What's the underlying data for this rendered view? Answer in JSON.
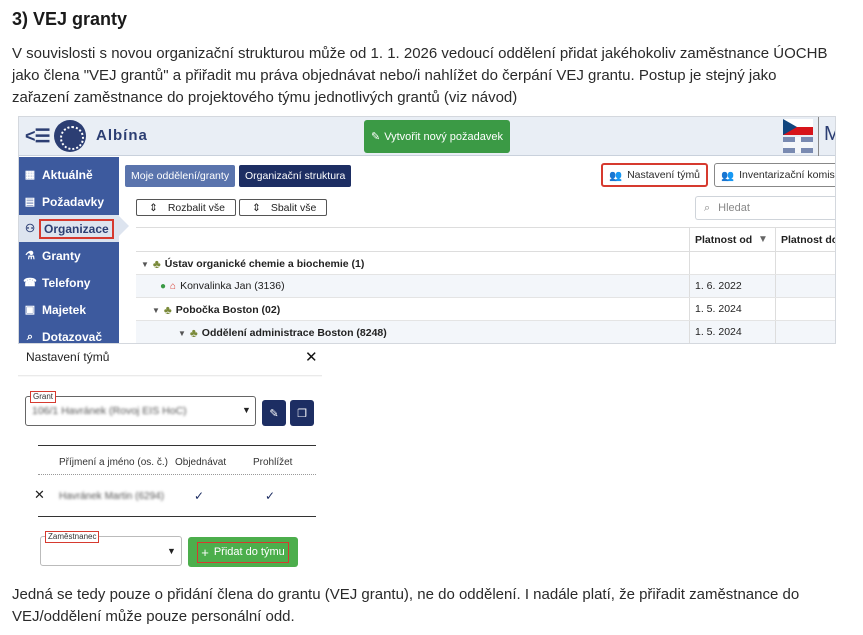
{
  "doc": {
    "heading": "3) VEJ granty",
    "intro_lines": [
      "V souvislosti s novou organizační strukturou může od 1. 1. 2026 vedoucí oddělení přidat jakéhokoliv zaměstnance ÚOCHB",
      "jako člena \"VEJ grantů\" a přiřadit mu práva objednávat nebo/i nahlížet do čerpání VEJ grantu. Postup je stejný jako",
      "zařazení zaměstnance do projektového týmu jednotlivých grantů (viz návod)"
    ],
    "outro_lines": [
      "Jedná se tedy pouze o přidání člena do grantu (VEJ grantu), ne do oddělení. I nadále platí, že přiřadit zaměstnance do",
      "VEJ/oddělení může pouze personální odd."
    ]
  },
  "app": {
    "name": "Albína",
    "create_request": "Vytvořit nový požadavek",
    "header_cut_text": "M",
    "sidebar": [
      {
        "label": "Aktuálně",
        "icon": "calendar-icon",
        "glyph": "▦"
      },
      {
        "label": "Požadavky",
        "icon": "document-icon",
        "glyph": "▤"
      },
      {
        "label": "Organizace",
        "icon": "org-chart-icon",
        "glyph": "⚇"
      },
      {
        "label": "Granty",
        "icon": "flask-icon",
        "glyph": "⚗"
      },
      {
        "label": "Telefony",
        "icon": "phone-icon",
        "glyph": "☎"
      },
      {
        "label": "Majetek",
        "icon": "briefcase-icon",
        "glyph": "▣"
      },
      {
        "label": "Dotazovač",
        "icon": "search-icon",
        "glyph": "⌕"
      }
    ],
    "active_sidebar": "Organizace",
    "tabs": [
      "Moje oddělení/granty",
      "Organizační struktura"
    ],
    "team_settings_btn": "Nastavení týmů",
    "inventory_btn": "Inventarizační komise",
    "expand_all": "Rozbalit vše",
    "collapse_all": "Sbalit vše",
    "search_placeholder": "Hledat",
    "columns": [
      "Platnost od",
      "Platnost do"
    ],
    "rows": [
      {
        "name": "Ústav organické chemie a biochemie (1)",
        "valid_from": "",
        "bold": true
      },
      {
        "name": "Konvalinka Jan (3136)",
        "valid_from": "1. 6. 2022",
        "bold": false
      },
      {
        "name": "Pobočka Boston (02)",
        "valid_from": "1. 5. 2024",
        "bold": true
      },
      {
        "name": "Oddělení administrace Boston (8248)",
        "valid_from": "1. 5. 2024",
        "bold": true
      }
    ]
  },
  "dialog": {
    "title": "Nastavení týmů",
    "grant_label": "Grant",
    "grant_value": "106/1 Havránek (Rovoj EIS HoC)",
    "columns": [
      "Příjmení a jméno (os. č.)",
      "Objednávat",
      "Prohlížet"
    ],
    "member": {
      "name": "Havránek Martin (6294)",
      "order": true,
      "view": true
    },
    "employee_label": "Zaměstnanec",
    "add_button": "Přidat do týmu"
  },
  "colors": {
    "sidebar": "#3d5a9e",
    "navy": "#1d2e63",
    "green": "#3b9a45",
    "highlight": "#d63a2f"
  }
}
